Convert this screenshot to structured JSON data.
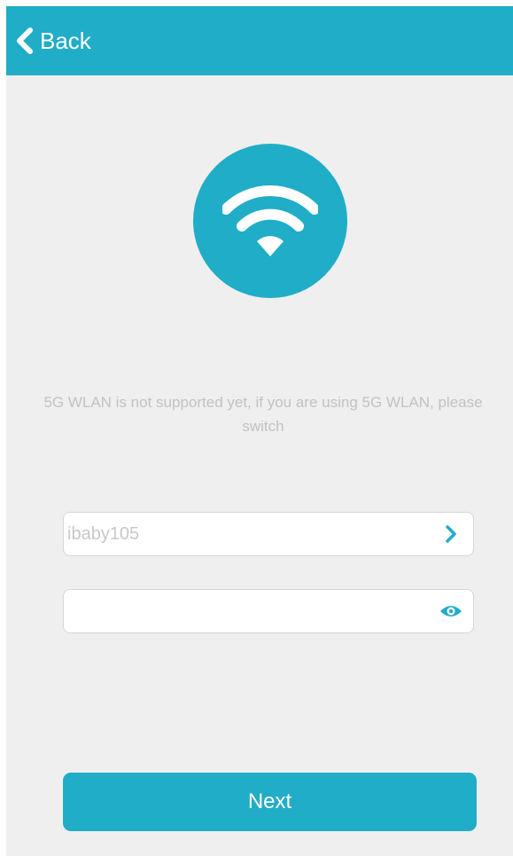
{
  "header": {
    "back_label": "Back",
    "back_icon": "chevron-left-icon"
  },
  "main": {
    "hero_icon": "wifi-icon",
    "hint": "5G WLAN is not supported yet, if you are using 5G WLAN, please switch",
    "ssid_field": {
      "value": "ibaby105",
      "icon": "chevron-right-icon"
    },
    "password_field": {
      "value": "",
      "icon": "eye-icon"
    },
    "next_label": "Next"
  },
  "colors": {
    "accent": "#20adc8",
    "background": "#efefef",
    "hint_text": "#c2c2c2"
  }
}
